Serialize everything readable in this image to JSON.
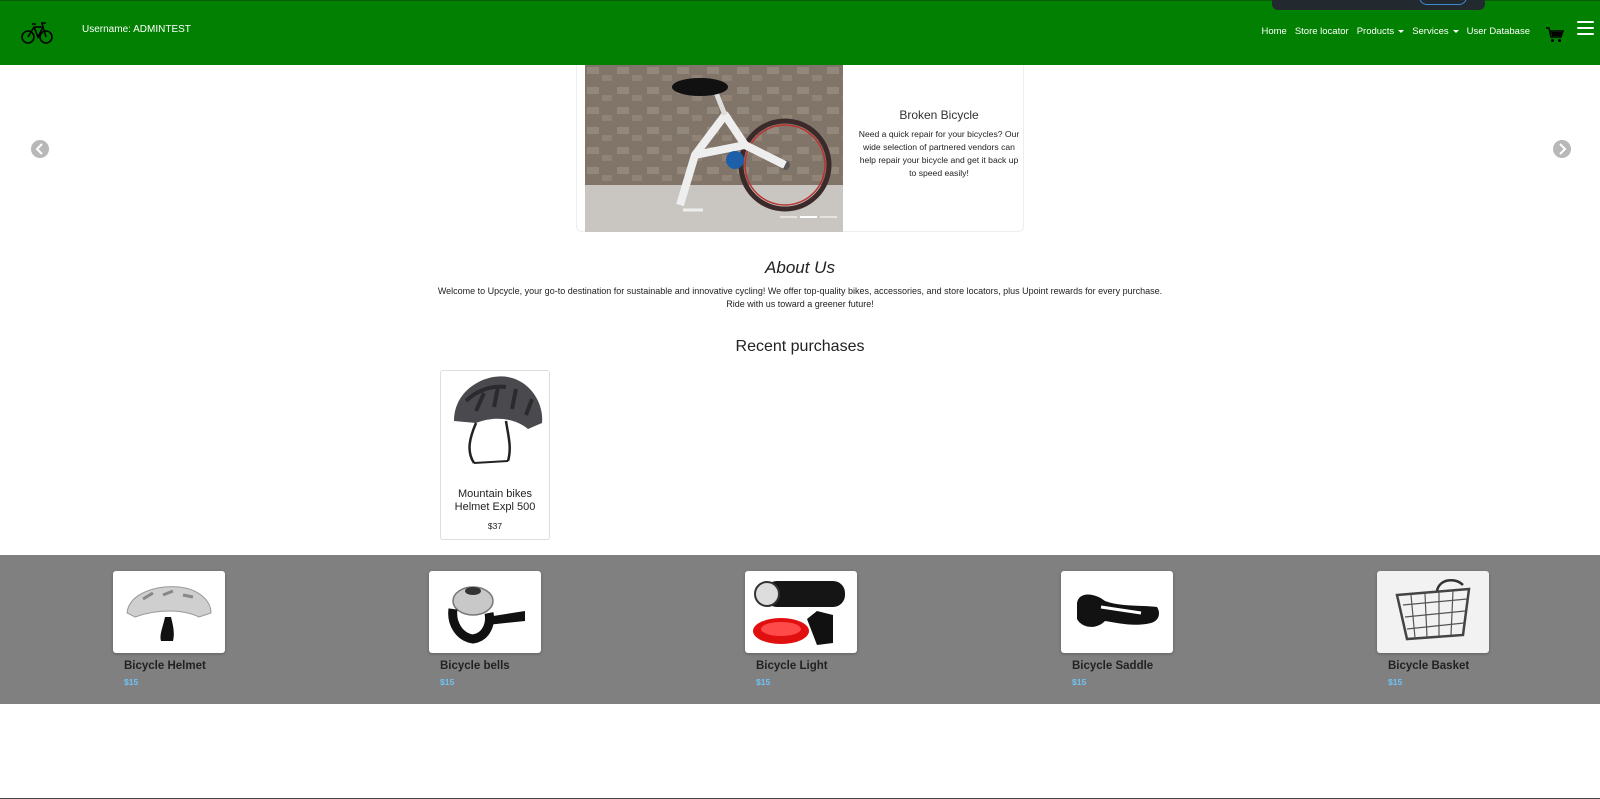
{
  "header": {
    "username": "Username: ADMINTEST",
    "nav": {
      "home": "Home",
      "store_locator": "Store locator",
      "products": "Products",
      "services": "Services",
      "user_database": "User Database"
    },
    "color": "#018001"
  },
  "carousel": {
    "title": "Broken Bicycle",
    "text": "Need a quick repair for your bicycles? Our wide selection of partnered vendors can help repair your bicycle and get it back up to speed easily!"
  },
  "about": {
    "title": "About Us",
    "text": "Welcome to Upcycle, your go-to destination for sustainable and innovative cycling! We offer top-quality bikes, accessories, and store locators, plus Upoint rewards for every purchase. Ride with us toward a greener future!"
  },
  "recent": {
    "title": "Recent purchases",
    "items": [
      {
        "name": "Mountain bikes Helmet Expl 500",
        "price": "$37"
      }
    ]
  },
  "featured": {
    "items": [
      {
        "name": "Bicycle Helmet",
        "price": "$15",
        "icon": "helmet-icon"
      },
      {
        "name": "Bicycle bells",
        "price": "$15",
        "icon": "bell-icon"
      },
      {
        "name": "Bicycle Light",
        "price": "$15",
        "icon": "light-icon"
      },
      {
        "name": "Bicycle Saddle",
        "price": "$15",
        "icon": "saddle-icon"
      },
      {
        "name": "Bicycle Basket",
        "price": "$15",
        "icon": "basket-icon"
      }
    ],
    "price_color": "#6ec3f5",
    "background": "#808080"
  }
}
